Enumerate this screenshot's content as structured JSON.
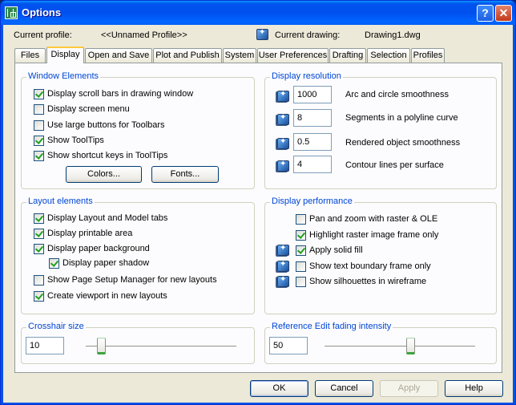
{
  "window": {
    "title": "Options",
    "help_label": "?",
    "close_label": "✕"
  },
  "header": {
    "profile_label": "Current profile:",
    "profile_value": "<<Unnamed Profile>>",
    "drawing_label": "Current drawing:",
    "drawing_value": "Drawing1.dwg"
  },
  "tabs": [
    {
      "label": "Files",
      "active": false
    },
    {
      "label": "Display",
      "active": true
    },
    {
      "label": "Open and Save",
      "active": false
    },
    {
      "label": "Plot and Publish",
      "active": false
    },
    {
      "label": "System",
      "active": false
    },
    {
      "label": "User Preferences",
      "active": false
    },
    {
      "label": "Drafting",
      "active": false
    },
    {
      "label": "Selection",
      "active": false
    },
    {
      "label": "Profiles",
      "active": false
    }
  ],
  "window_elements": {
    "title": "Window Elements",
    "items": [
      {
        "label": "Display scroll bars in drawing window",
        "checked": true
      },
      {
        "label": "Display screen menu",
        "checked": false
      },
      {
        "label": "Use large buttons for Toolbars",
        "checked": false
      },
      {
        "label": "Show ToolTips",
        "checked": true
      },
      {
        "label": "Show shortcut keys in ToolTips",
        "checked": true
      }
    ],
    "colors_button": "Colors...",
    "fonts_button": "Fonts..."
  },
  "display_resolution": {
    "title": "Display resolution",
    "items": [
      {
        "value": "1000",
        "label": "Arc and circle smoothness",
        "icon": "drawing-setting-icon"
      },
      {
        "value": "8",
        "label": "Segments in a polyline curve",
        "icon": "drawing-setting-icon"
      },
      {
        "value": "0.5",
        "label": "Rendered object smoothness",
        "icon": "drawing-setting-icon"
      },
      {
        "value": "4",
        "label": "Contour lines per surface",
        "icon": "drawing-setting-icon"
      }
    ]
  },
  "layout_elements": {
    "title": "Layout elements",
    "items": [
      {
        "label": "Display Layout and Model tabs",
        "checked": true
      },
      {
        "label": "Display printable area",
        "checked": true
      },
      {
        "label": "Display paper background",
        "checked": true
      },
      {
        "label": "Display paper shadow",
        "checked": true
      },
      {
        "label": "Show Page Setup Manager for new layouts",
        "checked": false
      },
      {
        "label": "Create viewport in new layouts",
        "checked": true
      }
    ]
  },
  "display_performance": {
    "title": "Display performance",
    "items": [
      {
        "label": "Pan and zoom with raster & OLE",
        "checked": false,
        "drawing_icon": false
      },
      {
        "label": "Highlight raster image frame only",
        "checked": true,
        "drawing_icon": false
      },
      {
        "label": "Apply solid fill",
        "checked": true,
        "drawing_icon": true
      },
      {
        "label": "Show text boundary frame only",
        "checked": false,
        "drawing_icon": true
      },
      {
        "label": "Show silhouettes in wireframe",
        "checked": false,
        "drawing_icon": true
      }
    ]
  },
  "crosshair": {
    "title": "Crosshair size",
    "value": "10",
    "slider_fraction": 0.1
  },
  "refedit": {
    "title": "Reference Edit fading intensity",
    "value": "50",
    "slider_fraction": 0.57
  },
  "footer": {
    "ok": "OK",
    "cancel": "Cancel",
    "apply": "Apply",
    "help": "Help"
  }
}
